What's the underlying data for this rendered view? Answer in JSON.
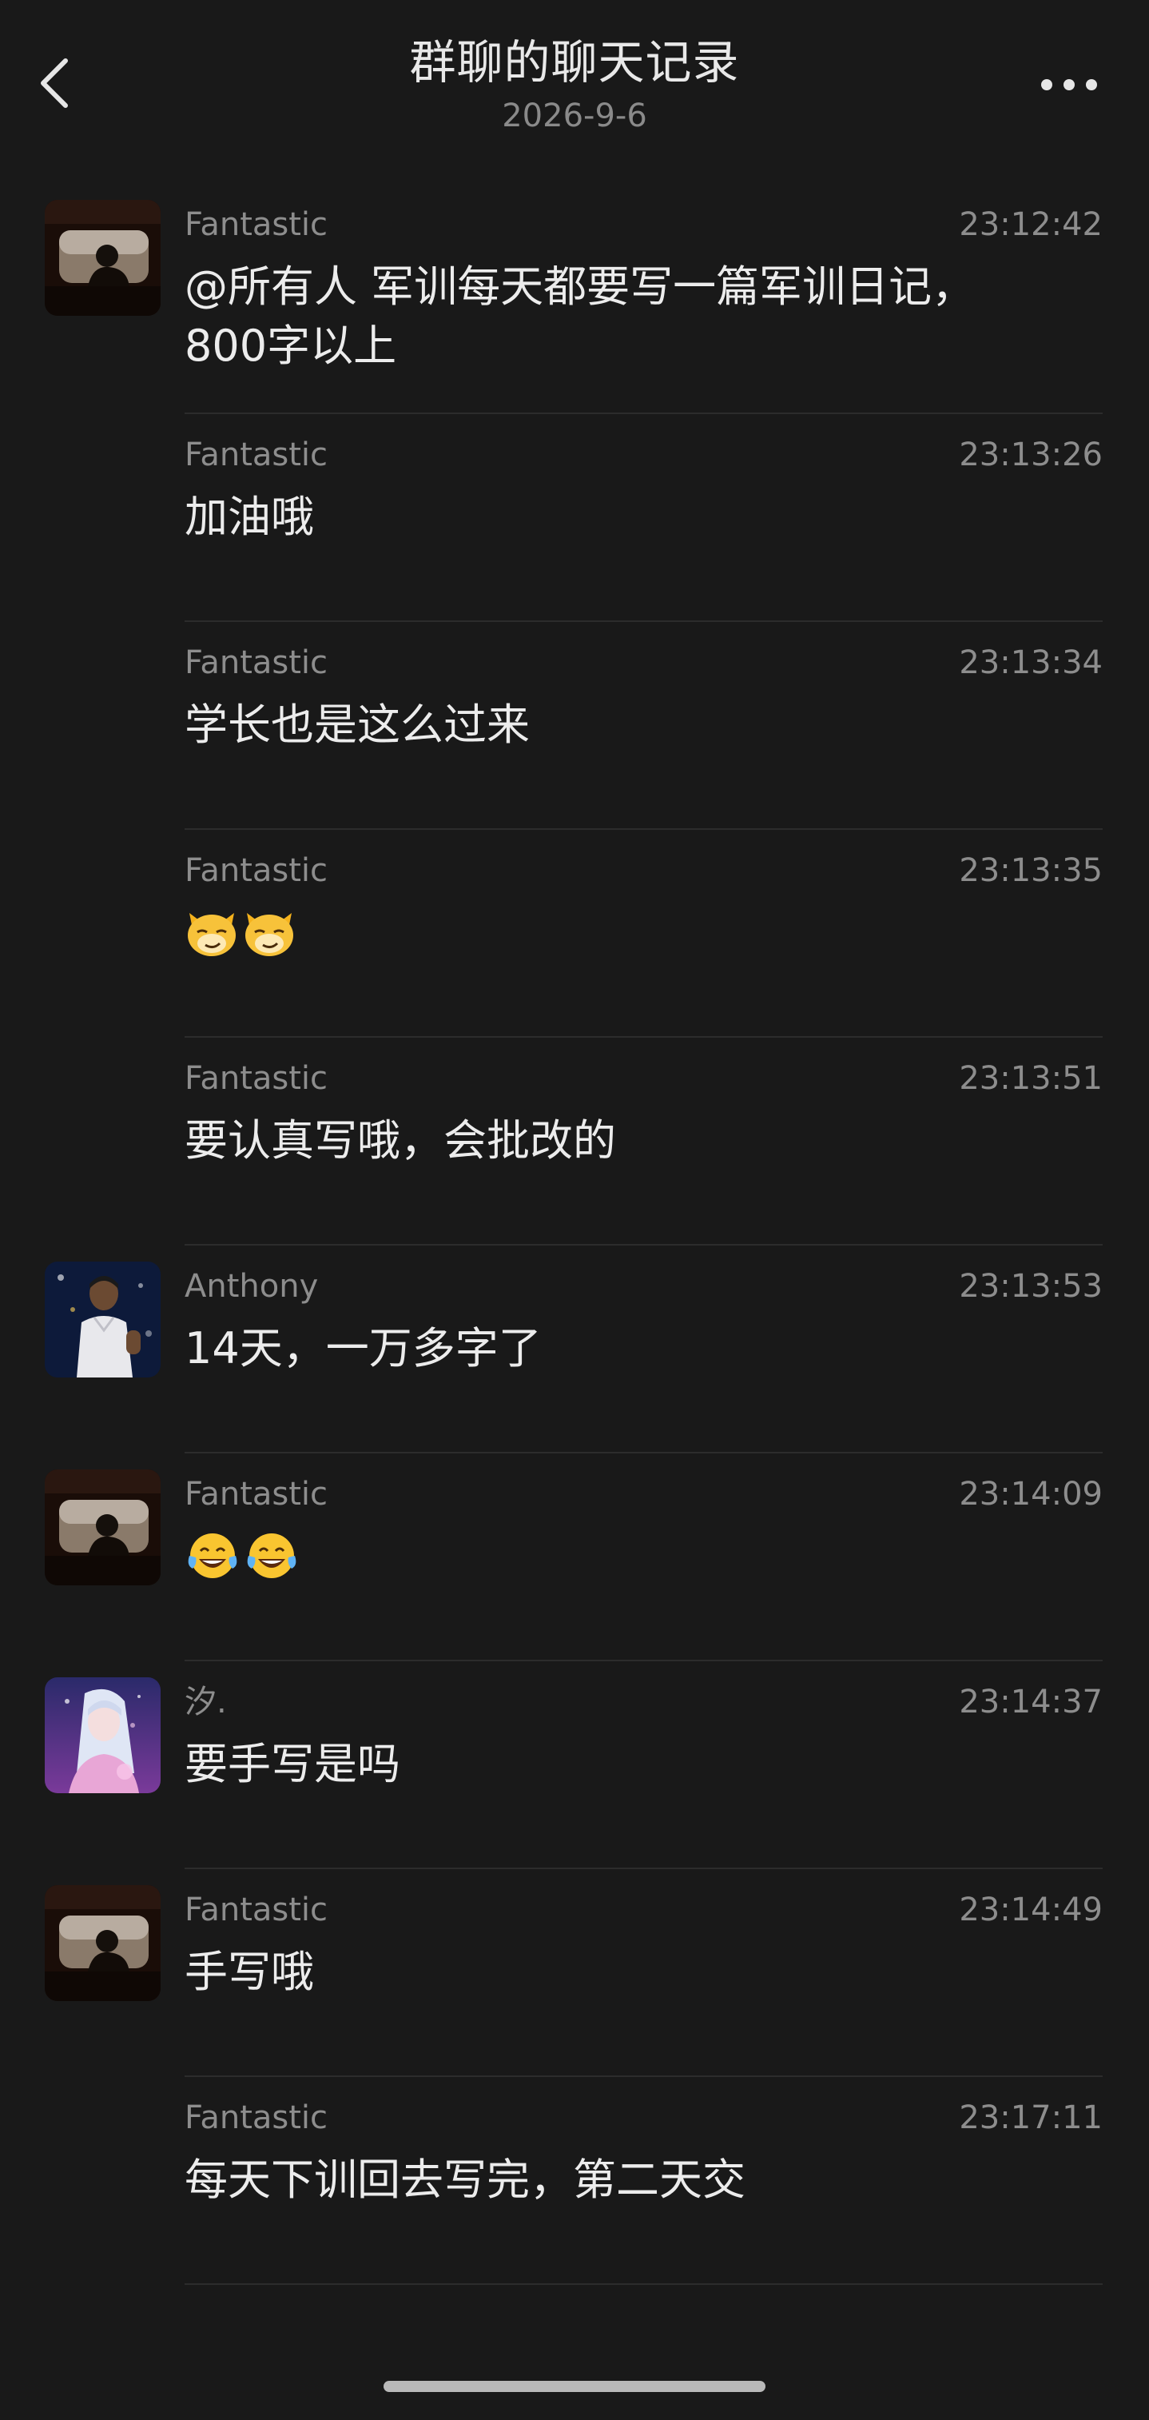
{
  "header": {
    "title": "群聊的聊天记录",
    "date": "2026-9-6"
  },
  "messages": [
    {
      "sender": "Fantastic",
      "time": "23:12:42",
      "text": "@所有人 军训每天都要写一篇军训日记，\n800字以上",
      "avatar": "window-silhouette-avatar"
    },
    {
      "sender": "Fantastic",
      "time": "23:13:26",
      "text": "加油哦",
      "avatar": ""
    },
    {
      "sender": "Fantastic",
      "time": "23:13:34",
      "text": "学长也是这么过来",
      "avatar": ""
    },
    {
      "sender": "Fantastic",
      "time": "23:13:35",
      "text": "",
      "emoji": [
        "smirk-cat-emoji",
        "smirk-cat-emoji"
      ],
      "avatar": ""
    },
    {
      "sender": "Fantastic",
      "time": "23:13:51",
      "text": "要认真写哦，会批改的",
      "avatar": ""
    },
    {
      "sender": "Anthony",
      "time": "23:13:53",
      "text": "14天，一万多字了",
      "avatar": "basketball-player-avatar"
    },
    {
      "sender": "Fantastic",
      "time": "23:14:09",
      "text": "",
      "emoji": [
        "tears-of-joy-emoji",
        "tears-of-joy-emoji"
      ],
      "avatar": "window-silhouette-avatar"
    },
    {
      "sender": "汐.",
      "time": "23:14:37",
      "text": "要手写是吗",
      "avatar": "anime-girl-avatar"
    },
    {
      "sender": "Fantastic",
      "time": "23:14:49",
      "text": "手写哦",
      "avatar": "window-silhouette-avatar"
    },
    {
      "sender": "Fantastic",
      "time": "23:17:11",
      "text": "每天下训回去写完，第二天交",
      "avatar": ""
    }
  ],
  "colors": {
    "background": "#191919",
    "text": "#ececec",
    "secondary_text": "#8d8d8d",
    "divider": "#2c2c2c"
  }
}
